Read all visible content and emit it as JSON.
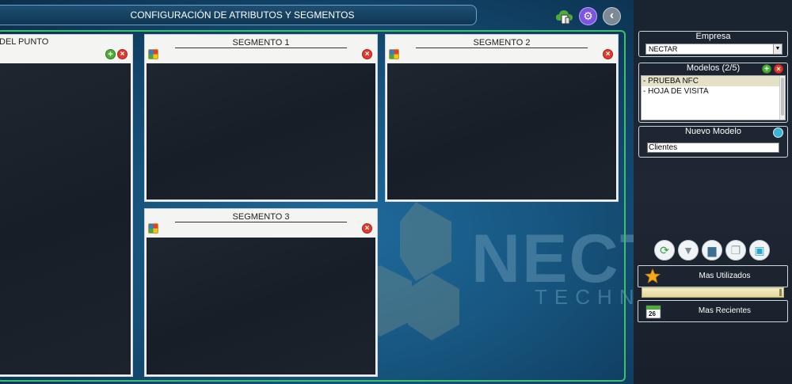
{
  "header": {
    "title": "CONFIGURACIÓN DE ATRIBUTOS Y SEGMENTOS"
  },
  "panels": [
    {
      "title": "DEL PUNTO"
    },
    {
      "title": "SEGMENTO 1"
    },
    {
      "title": "SEGMENTO 2"
    },
    {
      "title": "SEGMENTO 3"
    }
  ],
  "watermark": {
    "text": "NECT",
    "sub": "TECHNO"
  },
  "sidebar": {
    "empresa": {
      "label": "Empresa",
      "value": "NECTAR"
    },
    "modelos": {
      "label": "Modelos (2/5)",
      "items": [
        "- PRUEBA NFC",
        "- HOJA DE VISITA"
      ]
    },
    "nuevo_modelo": {
      "label": "Nuevo Modelo",
      "value": "Clientes"
    },
    "menu": {
      "mas_utilizados": "Mas Utilizados",
      "mas_recientes": "Mas Recientes",
      "calendar_day": "26"
    }
  },
  "icons": {
    "cloud": "cloud-device-icon",
    "gear": "gear-icon",
    "back": "chevron-left-icon",
    "refresh": "refresh-icon",
    "filter": "filter-icon",
    "print": "print-icon",
    "copy": "copy-icon",
    "save": "save-icon",
    "star": "star-icon",
    "calendar": "calendar-icon"
  },
  "colors": {
    "accent_purple": "#7b54e0",
    "frame_green": "#3fbf6a",
    "delete_red": "#e03a2f",
    "add_green": "#4cae38"
  }
}
